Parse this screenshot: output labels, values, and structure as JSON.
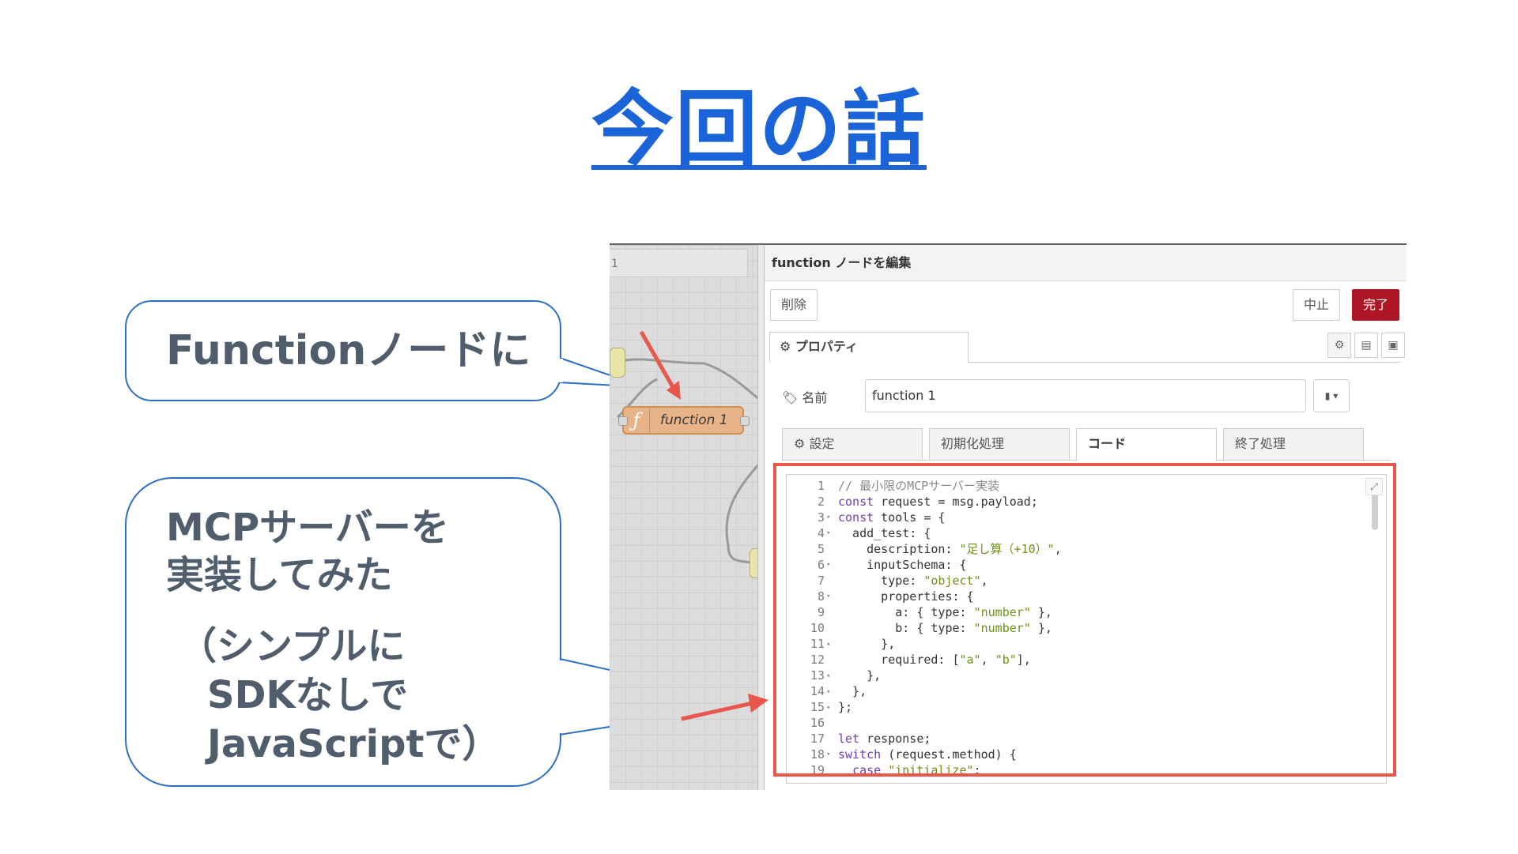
{
  "slide": {
    "title": "今回の話",
    "callout_top": {
      "text": "Functionノードに"
    },
    "callout_bottom": {
      "line1": "MCPサーバーを",
      "line2": "実装してみた",
      "line3": "（シンプルに",
      "line4": "SDKなしで",
      "line5": "JavaScriptで）"
    }
  },
  "canvas": {
    "tab_label": "1",
    "node_label": "function 1",
    "node_icon": "function-icon"
  },
  "editor_panel": {
    "header_title": "function ノードを編集",
    "delete_label": "削除",
    "cancel_label": "中止",
    "done_label": "完了",
    "properties_tab": "プロパティ",
    "name_label": "名前",
    "name_value": "function 1",
    "tabs": [
      "設定",
      "初期化処理",
      "コード",
      "終了処理"
    ],
    "active_tab": "コード",
    "code_lines": [
      {
        "n": "1",
        "fold": "",
        "text": "// 最小限のMCPサーバー実装"
      },
      {
        "n": "2",
        "fold": "",
        "text": "const request = msg.payload;"
      },
      {
        "n": "3",
        "fold": "▾",
        "text": "const tools = {"
      },
      {
        "n": "4",
        "fold": "▾",
        "text": "  add_test: {"
      },
      {
        "n": "5",
        "fold": "",
        "text": "    description: \"足し算（+10）\","
      },
      {
        "n": "6",
        "fold": "▾",
        "text": "    inputSchema: {"
      },
      {
        "n": "7",
        "fold": "",
        "text": "      type: \"object\","
      },
      {
        "n": "8",
        "fold": "▾",
        "text": "      properties: {"
      },
      {
        "n": "9",
        "fold": "",
        "text": "        a: { type: \"number\" },"
      },
      {
        "n": "10",
        "fold": "",
        "text": "        b: { type: \"number\" },"
      },
      {
        "n": "11",
        "fold": "▴",
        "text": "      },"
      },
      {
        "n": "12",
        "fold": "",
        "text": "      required: [\"a\", \"b\"],"
      },
      {
        "n": "13",
        "fold": "▴",
        "text": "    },"
      },
      {
        "n": "14",
        "fold": "▴",
        "text": "  },"
      },
      {
        "n": "15",
        "fold": "▴",
        "text": "};"
      },
      {
        "n": "16",
        "fold": "",
        "text": ""
      },
      {
        "n": "17",
        "fold": "",
        "text": "let response;"
      },
      {
        "n": "18",
        "fold": "▾",
        "text": "switch (request.method) {"
      },
      {
        "n": "19",
        "fold": "",
        "text": "  case \"initialize\":"
      }
    ]
  },
  "colors": {
    "title_blue": "#1a63d8",
    "bubble_border": "#2c6fc4",
    "highlight_red": "#e9574c",
    "done_button": "#ad1625",
    "node_orange": "#e8b389"
  }
}
